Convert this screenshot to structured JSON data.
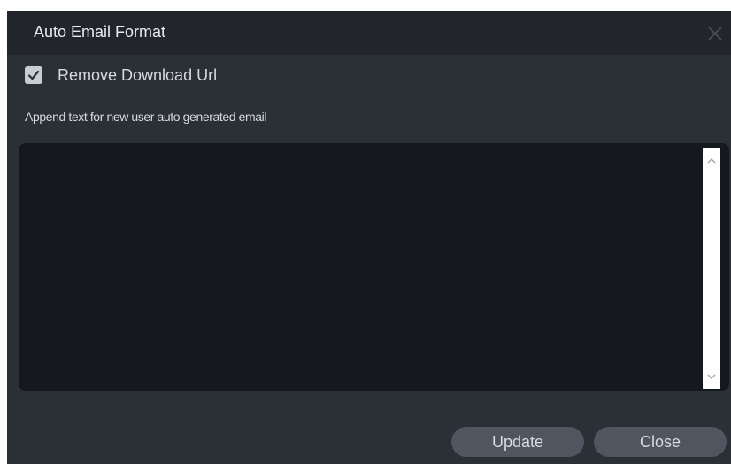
{
  "dialog": {
    "title": "Auto Email Format",
    "close_icon": "close-icon"
  },
  "options": {
    "remove_download_url": {
      "label": "Remove Download Url",
      "checked": true,
      "icon": "checkmark-icon"
    }
  },
  "append_text": {
    "label": "Append text for new user auto generated email",
    "value": "",
    "scroll_up_icon": "chevron-up-icon",
    "scroll_down_icon": "chevron-down-icon"
  },
  "buttons": {
    "update_label": "Update",
    "close_label": "Close"
  },
  "colors": {
    "dialog_bg": "#2b2f36",
    "titlebar_bg": "#22262c",
    "textarea_bg": "#15181e",
    "button_bg": "#4f5660",
    "checkbox_bg": "#c8ccd3"
  }
}
